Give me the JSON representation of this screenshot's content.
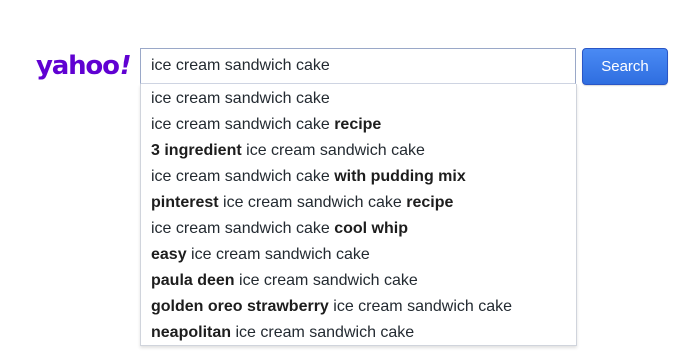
{
  "logo": {
    "text": "yahoo",
    "exclaim": "!",
    "color": "#6001d2"
  },
  "search": {
    "value": "ice cream sandwich cake",
    "button_label": "Search",
    "button_color": "#3b7ae8"
  },
  "suggestions": [
    {
      "prefix": "",
      "prefix_bold": "",
      "middle": "ice cream sandwich cake",
      "suffix_bold": ""
    },
    {
      "prefix": "",
      "prefix_bold": "",
      "middle": "ice cream sandwich cake ",
      "suffix_bold": "recipe"
    },
    {
      "prefix": "",
      "prefix_bold": "3 ingredient",
      "middle": " ice cream sandwich cake",
      "suffix_bold": ""
    },
    {
      "prefix": "",
      "prefix_bold": "",
      "middle": "ice cream sandwich cake ",
      "suffix_bold": "with pudding mix"
    },
    {
      "prefix": "",
      "prefix_bold": "pinterest",
      "middle": " ice cream sandwich cake ",
      "suffix_bold": "recipe"
    },
    {
      "prefix": "",
      "prefix_bold": "",
      "middle": "ice cream sandwich cake ",
      "suffix_bold": "cool whip"
    },
    {
      "prefix": "",
      "prefix_bold": "easy",
      "middle": " ice cream sandwich cake",
      "suffix_bold": ""
    },
    {
      "prefix": "",
      "prefix_bold": "paula deen",
      "middle": " ice cream sandwich cake",
      "suffix_bold": ""
    },
    {
      "prefix": "",
      "prefix_bold": "golden oreo strawberry",
      "middle": " ice cream sandwich cake",
      "suffix_bold": ""
    },
    {
      "prefix": "",
      "prefix_bold": "neapolitan",
      "middle": " ice cream sandwich cake",
      "suffix_bold": ""
    }
  ]
}
